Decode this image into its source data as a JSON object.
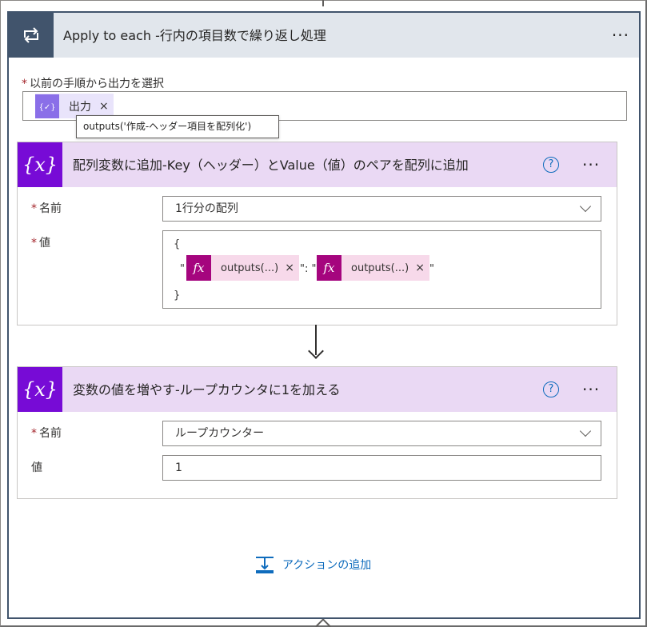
{
  "loop": {
    "title": "Apply to each -行内の項目数で繰り返し処理",
    "select_label": "以前の手順から出力を選択",
    "token_label": "出力",
    "token_remove": "×",
    "tooltip": "outputs('作成-ヘッダー項目を配列化')"
  },
  "cards": [
    {
      "icon": "{x}",
      "title": "配列変数に追加-Key（ヘッダー）とValue（値）のペアを配列に追加",
      "name_label": "名前",
      "name_value": "1行分の配列",
      "value_label": "値",
      "code_open": "{",
      "code_close": "}",
      "quote_open": "\"",
      "separator": "\": \"",
      "quote_close": "\"",
      "expressions": [
        {
          "icon": "fx",
          "label": "outputs(...)",
          "remove": "×"
        },
        {
          "icon": "fx",
          "label": "outputs(...)",
          "remove": "×"
        }
      ]
    },
    {
      "icon": "{x}",
      "title": "変数の値を増やす-ループカウンタに1を加える",
      "name_label": "名前",
      "name_value": "ループカウンター",
      "value_label": "値",
      "value": "1"
    }
  ],
  "required_mark": "*",
  "more_label": "···",
  "help_label": "?",
  "add_action": "アクションの追加",
  "colors": {
    "loop_header": "#e1e6ec",
    "loop_icon": "#41546c",
    "variable_header": "#ead9f4",
    "variable_icon": "#770bd6",
    "expression_icon": "#a5057e",
    "expression_token": "#f7d9ea",
    "dynamic_token_icon": "#8a6fe8",
    "link": "#0f6cbd",
    "required": "#a4262c"
  },
  "icons": {
    "loop": "loop-arrows-icon",
    "variable": "variable-braces-icon",
    "expression": "fx-icon",
    "dynamic": "dynamic-content-icon",
    "help": "help-circle-icon",
    "more": "more-dots-icon",
    "add": "insert-step-icon"
  }
}
